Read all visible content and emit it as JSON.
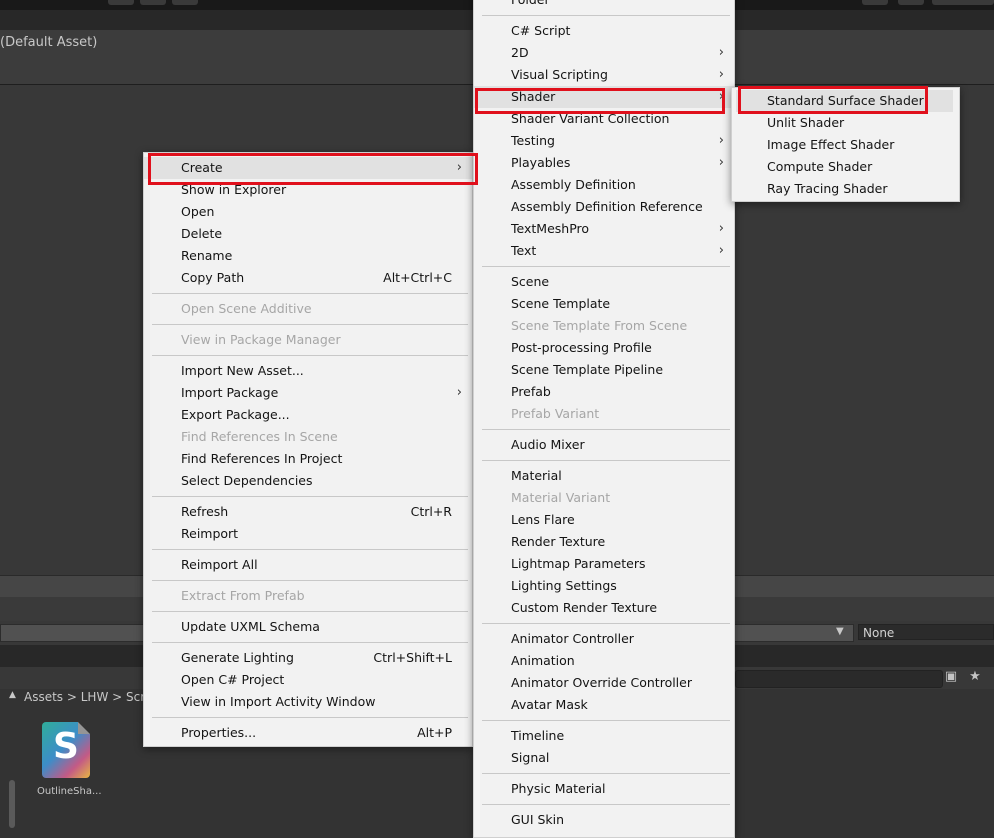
{
  "inspector": {
    "title": "(Default Asset)"
  },
  "dropdown": {
    "none_value": "None"
  },
  "project": {
    "breadcrumb": "Assets  >  LHW  >  Scr",
    "asset_label": "OutlineSha...",
    "asset_glyph": "S"
  },
  "context_menu": {
    "items": [
      {
        "label": "Create",
        "submenu": true,
        "highlight": true
      },
      {
        "label": "Show in Explorer"
      },
      {
        "label": "Open"
      },
      {
        "label": "Delete"
      },
      {
        "label": "Rename"
      },
      {
        "label": "Copy Path",
        "shortcut": "Alt+Ctrl+C"
      },
      {
        "sep": true
      },
      {
        "label": "Open Scene Additive",
        "disabled": true
      },
      {
        "sep": true
      },
      {
        "label": "View in Package Manager",
        "disabled": true
      },
      {
        "sep": true
      },
      {
        "label": "Import New Asset..."
      },
      {
        "label": "Import Package",
        "submenu": true
      },
      {
        "label": "Export Package..."
      },
      {
        "label": "Find References In Scene",
        "disabled": true
      },
      {
        "label": "Find References In Project"
      },
      {
        "label": "Select Dependencies"
      },
      {
        "sep": true
      },
      {
        "label": "Refresh",
        "shortcut": "Ctrl+R"
      },
      {
        "label": "Reimport"
      },
      {
        "sep": true
      },
      {
        "label": "Reimport All"
      },
      {
        "sep": true
      },
      {
        "label": "Extract From Prefab",
        "disabled": true
      },
      {
        "sep": true
      },
      {
        "label": "Update UXML Schema"
      },
      {
        "sep": true
      },
      {
        "label": "Generate Lighting",
        "shortcut": "Ctrl+Shift+L"
      },
      {
        "label": "Open C# Project"
      },
      {
        "label": "View in Import Activity Window"
      },
      {
        "sep": true
      },
      {
        "label": "Properties...",
        "shortcut": "Alt+P"
      }
    ]
  },
  "create_menu": {
    "items": [
      {
        "label": "Folder"
      },
      {
        "sep": true
      },
      {
        "label": "C# Script"
      },
      {
        "label": "2D",
        "submenu": true
      },
      {
        "label": "Visual Scripting",
        "submenu": true
      },
      {
        "label": "Shader",
        "submenu": true,
        "highlight": true
      },
      {
        "label": "Shader Variant Collection"
      },
      {
        "label": "Testing",
        "submenu": true
      },
      {
        "label": "Playables",
        "submenu": true
      },
      {
        "label": "Assembly Definition"
      },
      {
        "label": "Assembly Definition Reference"
      },
      {
        "label": "TextMeshPro",
        "submenu": true
      },
      {
        "label": "Text",
        "submenu": true
      },
      {
        "sep": true
      },
      {
        "label": "Scene"
      },
      {
        "label": "Scene Template"
      },
      {
        "label": "Scene Template From Scene",
        "disabled": true
      },
      {
        "label": "Post-processing Profile"
      },
      {
        "label": "Scene Template Pipeline"
      },
      {
        "label": "Prefab"
      },
      {
        "label": "Prefab Variant",
        "disabled": true
      },
      {
        "sep": true
      },
      {
        "label": "Audio Mixer"
      },
      {
        "sep": true
      },
      {
        "label": "Material"
      },
      {
        "label": "Material Variant",
        "disabled": true
      },
      {
        "label": "Lens Flare"
      },
      {
        "label": "Render Texture"
      },
      {
        "label": "Lightmap Parameters"
      },
      {
        "label": "Lighting Settings"
      },
      {
        "label": "Custom Render Texture"
      },
      {
        "sep": true
      },
      {
        "label": "Animator Controller"
      },
      {
        "label": "Animation"
      },
      {
        "label": "Animator Override Controller"
      },
      {
        "label": "Avatar Mask"
      },
      {
        "sep": true
      },
      {
        "label": "Timeline"
      },
      {
        "label": "Signal"
      },
      {
        "sep": true
      },
      {
        "label": "Physic Material"
      },
      {
        "sep": true
      },
      {
        "label": "GUI Skin"
      }
    ]
  },
  "shader_menu": {
    "items": [
      {
        "label": "Standard Surface Shader",
        "highlight": true
      },
      {
        "label": "Unlit Shader"
      },
      {
        "label": "Image Effect Shader"
      },
      {
        "label": "Compute Shader"
      },
      {
        "label": "Ray Tracing Shader"
      }
    ]
  },
  "icons": {
    "submenu_arrow": "›",
    "dropdown_arrow": "▼",
    "search_by_type": "▣",
    "favorites": "★"
  },
  "colors": {
    "highlight_box": "#e0101c",
    "menu_bg": "#f2f2f2",
    "menu_text": "#141414",
    "menu_disabled": "#a6a6a6",
    "editor_bg": "#383838"
  }
}
